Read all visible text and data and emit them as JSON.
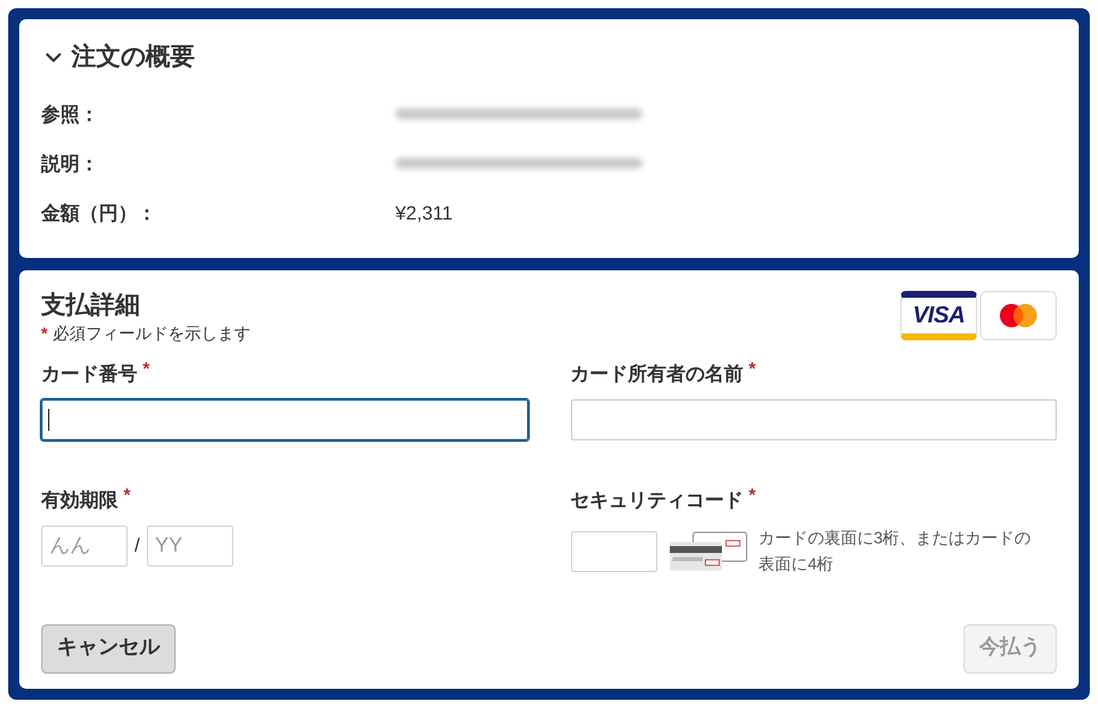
{
  "summary": {
    "title": "注文の概要",
    "expanded": true,
    "rows": [
      {
        "label": "参照：",
        "kind": "redacted"
      },
      {
        "label": "説明：",
        "kind": "redacted"
      },
      {
        "label": "金額（円）：",
        "kind": "text",
        "value": "¥2,311"
      }
    ]
  },
  "payment": {
    "title": "支払詳細",
    "brands": [
      {
        "kind": "visa",
        "label": "VISA"
      },
      {
        "kind": "mastercard"
      }
    ],
    "note": {
      "mark": "*",
      "text": "必須フィールドを示します"
    },
    "card_number": {
      "label": "カード番号",
      "mark": "*",
      "focused": true
    },
    "holder_name": {
      "label": "カード所有者の名前",
      "mark": "*",
      "focused": false
    },
    "expiry": {
      "label": "有効期限",
      "mark": "*",
      "month_placeholder": "んん",
      "separator": "/",
      "year_placeholder": "YY"
    },
    "security_code": {
      "label": "セキュリティコード",
      "mark": "*",
      "hint": "カードの裏面に3桁、またはカードの表面に4桁"
    },
    "cancel_button": {
      "label": "キャンセル",
      "disabled": false
    },
    "pay_button": {
      "label": "今払う",
      "disabled": true
    }
  }
}
